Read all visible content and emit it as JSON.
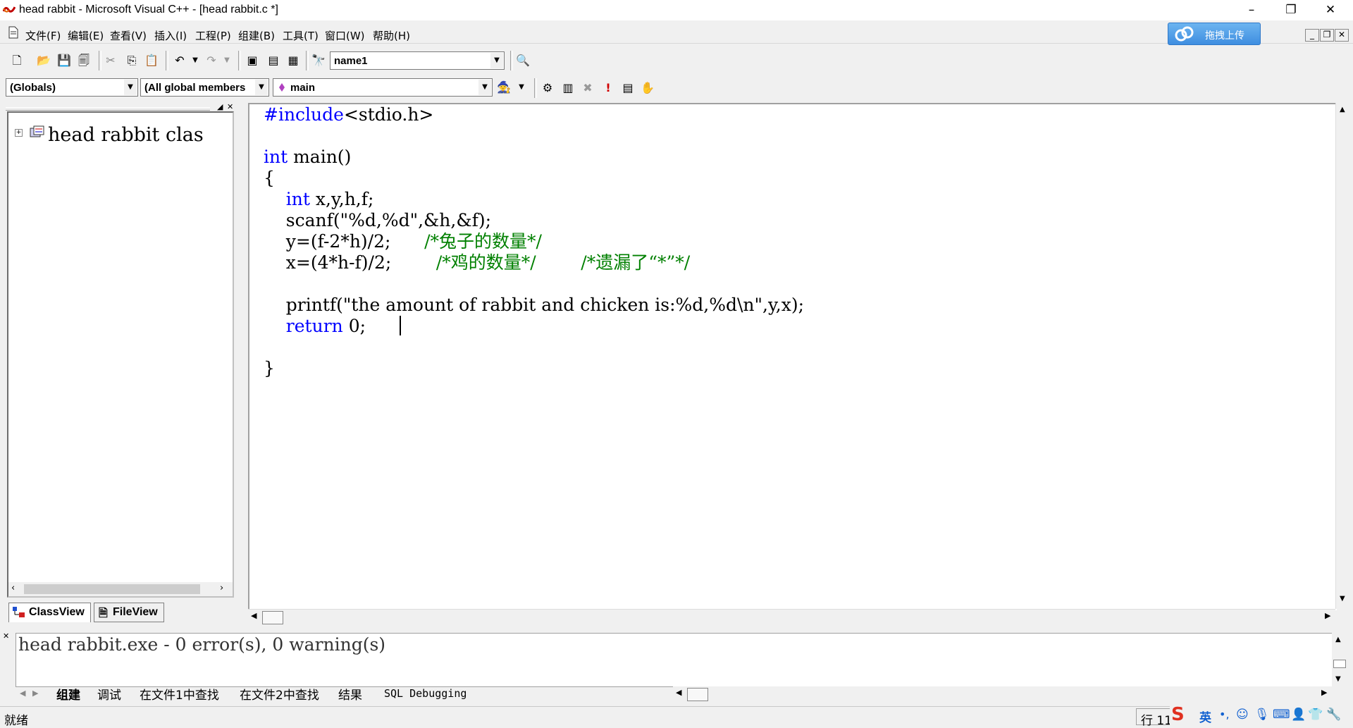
{
  "window": {
    "title": "head rabbit - Microsoft Visual C++ - [head rabbit.c *]",
    "minimize": "–",
    "restore": "❐",
    "close": "✕"
  },
  "menu": {
    "items": [
      "文件(F)",
      "编辑(E)",
      "查看(V)",
      "插入(I)",
      "工程(P)",
      "组建(B)",
      "工具(T)",
      "窗口(W)",
      "帮助(H)"
    ],
    "upload_label": "拖拽上传",
    "mdi_min": "_",
    "mdi_restore": "❐",
    "mdi_close": "✕"
  },
  "toolbar": {
    "find_combo": "name1",
    "icons": [
      "new-file-icon",
      "open-icon",
      "save-icon",
      "save-all-icon",
      "cut-icon",
      "copy-icon",
      "paste-icon",
      "undo-icon",
      "redo-icon",
      "workspace-icon",
      "output-window-icon",
      "window-list-icon",
      "find-in-files-icon",
      "search-icon"
    ]
  },
  "wizardbar": {
    "scope": "(Globals)",
    "members": "(All global members",
    "function": "main",
    "build_icons": [
      "compile-icon",
      "build-icon",
      "stop-build-icon",
      "execute-icon",
      "insert-breakpoint-icon",
      "hand-icon"
    ]
  },
  "workspace": {
    "tree_root": "head rabbit clas",
    "tabs": [
      "ClassView",
      "FileView"
    ]
  },
  "editor": {
    "lines": [
      {
        "parts": [
          {
            "t": "#include",
            "c": "kw"
          },
          {
            "t": "<stdio.h>",
            "c": ""
          }
        ]
      },
      {
        "parts": []
      },
      {
        "parts": [
          {
            "t": "int",
            "c": "kw"
          },
          {
            "t": " main()",
            "c": ""
          }
        ]
      },
      {
        "parts": [
          {
            "t": "{",
            "c": ""
          }
        ]
      },
      {
        "parts": [
          {
            "t": "    ",
            "c": ""
          },
          {
            "t": "int",
            "c": "kw"
          },
          {
            "t": " x,y,h,f;",
            "c": ""
          }
        ]
      },
      {
        "parts": [
          {
            "t": "    scanf(\"%d,%d\",&h,&f);",
            "c": ""
          }
        ]
      },
      {
        "parts": [
          {
            "t": "    y=(f-2*h)/2;      ",
            "c": ""
          },
          {
            "t": "/*兔子的数量*/",
            "c": "cm"
          }
        ]
      },
      {
        "parts": [
          {
            "t": "    x=(4*h-f)/2;        ",
            "c": ""
          },
          {
            "t": "/*鸡的数量*/        /*遗漏了“*”*/",
            "c": "cm"
          }
        ]
      },
      {
        "parts": []
      },
      {
        "parts": [
          {
            "t": "    printf(\"the amount of rabbit and chicken is:%d,%d\\n\",y,x);",
            "c": ""
          }
        ]
      },
      {
        "parts": [
          {
            "t": "    ",
            "c": ""
          },
          {
            "t": "return",
            "c": "kw"
          },
          {
            "t": " 0;",
            "c": ""
          }
        ]
      },
      {
        "parts": []
      },
      {
        "parts": [
          {
            "t": "}",
            "c": ""
          }
        ]
      }
    ]
  },
  "output": {
    "text": "head rabbit.exe - 0 error(s), 0 warning(s)",
    "tabs": [
      "组建",
      "调试",
      "在文件1中查找",
      "在文件2中查找",
      "结果",
      "SQL Debugging"
    ]
  },
  "status": {
    "left": "就绪",
    "line": "行 11",
    "ime_lang": "英"
  }
}
